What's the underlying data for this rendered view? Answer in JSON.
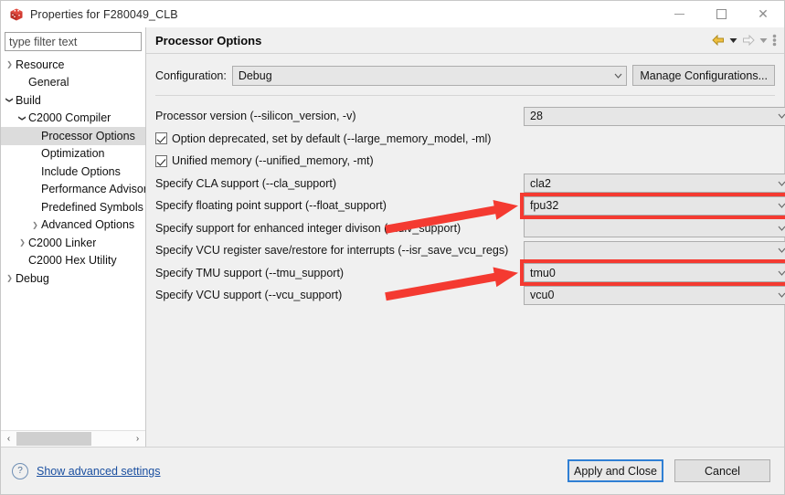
{
  "window": {
    "title": "Properties for F280049_CLB",
    "icon": "red-cube-icon",
    "minimize_label": "Minimize",
    "maximize_label": "Maximize",
    "close_label": "Close"
  },
  "sidebar": {
    "filter_placeholder": "type filter text",
    "filter_value": "",
    "items": [
      {
        "label": "Resource",
        "indent": 0,
        "twisty": "collapsed",
        "selected": false
      },
      {
        "label": "General",
        "indent": 1,
        "twisty": "none",
        "selected": false
      },
      {
        "label": "Build",
        "indent": 0,
        "twisty": "expanded",
        "selected": false
      },
      {
        "label": "C2000 Compiler",
        "indent": 1,
        "twisty": "expanded",
        "selected": false
      },
      {
        "label": "Processor Options",
        "indent": 2,
        "twisty": "none",
        "selected": true
      },
      {
        "label": "Optimization",
        "indent": 2,
        "twisty": "none",
        "selected": false
      },
      {
        "label": "Include Options",
        "indent": 2,
        "twisty": "none",
        "selected": false
      },
      {
        "label": "Performance Advisor",
        "indent": 2,
        "twisty": "none",
        "selected": false
      },
      {
        "label": "Predefined Symbols",
        "indent": 2,
        "twisty": "none",
        "selected": false
      },
      {
        "label": "Advanced Options",
        "indent": 2,
        "twisty": "collapsed",
        "selected": false
      },
      {
        "label": "C2000 Linker",
        "indent": 1,
        "twisty": "collapsed",
        "selected": false
      },
      {
        "label": "C2000 Hex Utility",
        "indent": 1,
        "twisty": "none",
        "selected": false
      },
      {
        "label": "Debug",
        "indent": 0,
        "twisty": "collapsed",
        "selected": false
      }
    ],
    "scroll_left_label": "‹",
    "scroll_right_label": "›"
  },
  "page": {
    "title": "Processor Options",
    "toolbar": {
      "back_icon": "back-arrow-icon",
      "back_menu_icon": "chevron-down-icon",
      "forward_icon": "forward-arrow-icon",
      "forward_menu_icon": "chevron-down-icon",
      "menu_icon": "view-menu-icon"
    },
    "configuration": {
      "label": "Configuration:",
      "value": "Debug",
      "manage_button": "Manage Configurations..."
    },
    "options": [
      {
        "label": "Processor version (--silicon_version, -v)",
        "type": "combo",
        "value": "28",
        "highlight": false
      },
      {
        "label": "Option deprecated, set by default (--large_memory_model, -ml)",
        "type": "checkbox",
        "checked": true
      },
      {
        "label": "Unified memory (--unified_memory, -mt)",
        "type": "checkbox",
        "checked": true
      },
      {
        "label": "Specify CLA support (--cla_support)",
        "type": "combo",
        "value": "cla2",
        "highlight": false
      },
      {
        "label": "Specify floating point support (--float_support)",
        "type": "combo",
        "value": "fpu32",
        "highlight": true
      },
      {
        "label": "Specify support for enhanced integer divison (--idiv_support)",
        "type": "combo",
        "value": "",
        "highlight": false
      },
      {
        "label": "Specify VCU register save/restore for interrupts (--isr_save_vcu_regs)",
        "type": "combo",
        "value": "",
        "highlight": false
      },
      {
        "label": "Specify TMU support (--tmu_support)",
        "type": "combo",
        "value": "tmu0",
        "highlight": true
      },
      {
        "label": "Specify VCU support (--vcu_support)",
        "type": "combo",
        "value": "vcu0",
        "highlight": false
      }
    ]
  },
  "footer": {
    "help_icon": "question-mark-icon",
    "advanced_link": "Show advanced settings",
    "apply_button": "Apply and Close",
    "cancel_button": "Cancel"
  },
  "annotations": {
    "highlight_color": "#f43a31",
    "arrow_color": "#f43a31",
    "arrows": [
      {
        "target": "float-support-combo"
      },
      {
        "target": "tmu-support-combo"
      }
    ]
  }
}
